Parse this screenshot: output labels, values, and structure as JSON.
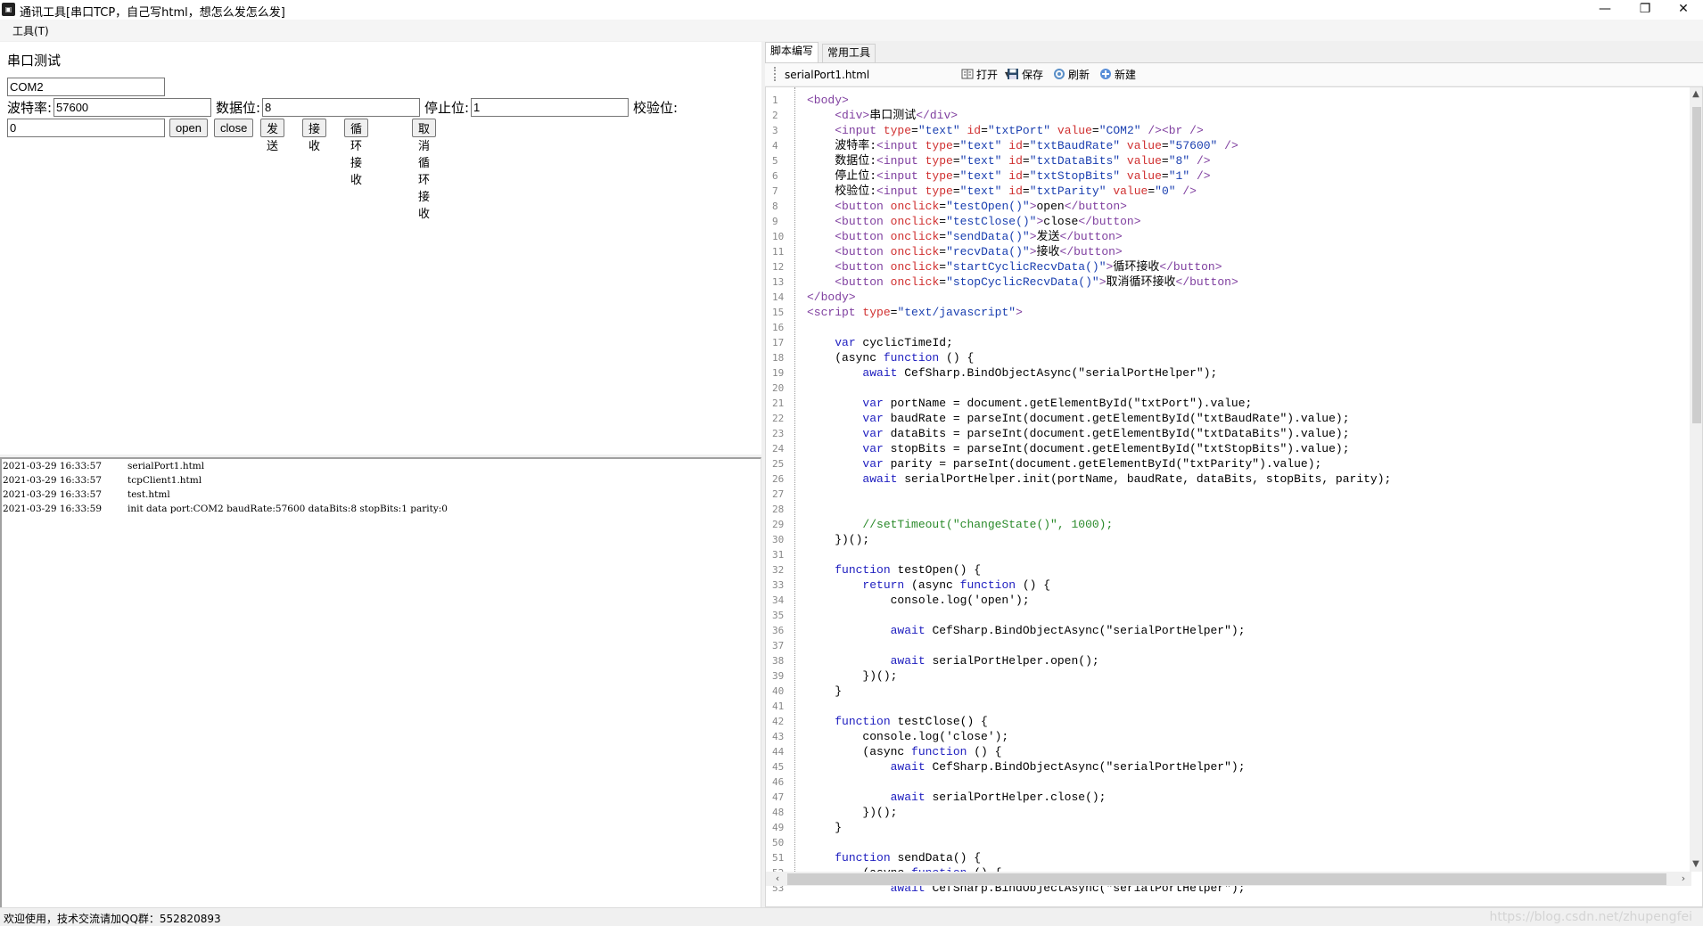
{
  "window": {
    "title": "通讯工具[串口TCP，自己写html，想怎么发怎么发]",
    "app_icon_glyph": "▣",
    "minimize_glyph": "—",
    "restore_glyph": "❐",
    "close_glyph": "✕"
  },
  "menu": {
    "items": [
      {
        "label": "工具(T)"
      }
    ]
  },
  "web_page": {
    "heading": "串口测试",
    "port_value": "COM2",
    "baud_label": "波特率:",
    "baud_value": "57600",
    "databits_label": "数据位:",
    "databits_value": "8",
    "stopbits_label": "停止位:",
    "stopbits_value": "1",
    "parity_label": "校验位:",
    "parity_value": "0",
    "buttons": {
      "open": "open",
      "close": "close",
      "send": "发送",
      "recv": "接收",
      "cyclic_recv": "循环接收",
      "cancel_cyclic_recv": "取消循环接收"
    }
  },
  "log": [
    {
      "time": "2021-03-29 16:33:57",
      "message": "serialPort1.html"
    },
    {
      "time": "2021-03-29 16:33:57",
      "message": "tcpClient1.html"
    },
    {
      "time": "2021-03-29 16:33:57",
      "message": "test.html"
    },
    {
      "time": "2021-03-29 16:33:59",
      "message": "init data port:COM2 baudRate:57600 dataBits:8 stopBits:1 parity:0"
    }
  ],
  "right_panel": {
    "tabs": [
      {
        "label": "脚本编写",
        "active": true
      },
      {
        "label": "常用工具",
        "active": false
      }
    ],
    "toolbar": {
      "selected_file": "serialPort1.html",
      "open_label": "打开",
      "save_label": "保存",
      "refresh_label": "刷新",
      "new_label": "新建"
    },
    "editor": {
      "scroll_vertical_fraction": 0.0,
      "lines": [
        [
          [
            "tag",
            "<body>"
          ]
        ],
        [
          [
            "plain",
            "    "
          ],
          [
            "tag",
            "<div>"
          ],
          [
            "plain",
            "串口测试"
          ],
          [
            "tag",
            "</div>"
          ]
        ],
        [
          [
            "plain",
            "    "
          ],
          [
            "tag",
            "<input "
          ],
          [
            "attr",
            "type"
          ],
          [
            "plain",
            "="
          ],
          [
            "val",
            "\"text\" "
          ],
          [
            "attr",
            "id"
          ],
          [
            "plain",
            "="
          ],
          [
            "val",
            "\"txtPort\" "
          ],
          [
            "attr",
            "value"
          ],
          [
            "plain",
            "="
          ],
          [
            "val",
            "\"COM2\" "
          ],
          [
            "tag",
            "/><br />"
          ]
        ],
        [
          [
            "plain",
            "    波特率:"
          ],
          [
            "tag",
            "<input "
          ],
          [
            "attr",
            "type"
          ],
          [
            "plain",
            "="
          ],
          [
            "val",
            "\"text\" "
          ],
          [
            "attr",
            "id"
          ],
          [
            "plain",
            "="
          ],
          [
            "val",
            "\"txtBaudRate\" "
          ],
          [
            "attr",
            "value"
          ],
          [
            "plain",
            "="
          ],
          [
            "val",
            "\"57600\" "
          ],
          [
            "tag",
            "/>"
          ]
        ],
        [
          [
            "plain",
            "    数据位:"
          ],
          [
            "tag",
            "<input "
          ],
          [
            "attr",
            "type"
          ],
          [
            "plain",
            "="
          ],
          [
            "val",
            "\"text\" "
          ],
          [
            "attr",
            "id"
          ],
          [
            "plain",
            "="
          ],
          [
            "val",
            "\"txtDataBits\" "
          ],
          [
            "attr",
            "value"
          ],
          [
            "plain",
            "="
          ],
          [
            "val",
            "\"8\" "
          ],
          [
            "tag",
            "/>"
          ]
        ],
        [
          [
            "plain",
            "    停止位:"
          ],
          [
            "tag",
            "<input "
          ],
          [
            "attr",
            "type"
          ],
          [
            "plain",
            "="
          ],
          [
            "val",
            "\"text\" "
          ],
          [
            "attr",
            "id"
          ],
          [
            "plain",
            "="
          ],
          [
            "val",
            "\"txtStopBits\" "
          ],
          [
            "attr",
            "value"
          ],
          [
            "plain",
            "="
          ],
          [
            "val",
            "\"1\" "
          ],
          [
            "tag",
            "/>"
          ]
        ],
        [
          [
            "plain",
            "    校验位:"
          ],
          [
            "tag",
            "<input "
          ],
          [
            "attr",
            "type"
          ],
          [
            "plain",
            "="
          ],
          [
            "val",
            "\"text\" "
          ],
          [
            "attr",
            "id"
          ],
          [
            "plain",
            "="
          ],
          [
            "val",
            "\"txtParity\" "
          ],
          [
            "attr",
            "value"
          ],
          [
            "plain",
            "="
          ],
          [
            "val",
            "\"0\" "
          ],
          [
            "tag",
            "/>"
          ]
        ],
        [
          [
            "plain",
            "    "
          ],
          [
            "tag",
            "<button "
          ],
          [
            "attr",
            "onclick"
          ],
          [
            "plain",
            "="
          ],
          [
            "val",
            "\"testOpen()\""
          ],
          [
            "tag",
            ">"
          ],
          [
            "plain",
            "open"
          ],
          [
            "tag",
            "</button>"
          ]
        ],
        [
          [
            "plain",
            "    "
          ],
          [
            "tag",
            "<button "
          ],
          [
            "attr",
            "onclick"
          ],
          [
            "plain",
            "="
          ],
          [
            "val",
            "\"testClose()\""
          ],
          [
            "tag",
            ">"
          ],
          [
            "plain",
            "close"
          ],
          [
            "tag",
            "</button>"
          ]
        ],
        [
          [
            "plain",
            "    "
          ],
          [
            "tag",
            "<button "
          ],
          [
            "attr",
            "onclick"
          ],
          [
            "plain",
            "="
          ],
          [
            "val",
            "\"sendData()\""
          ],
          [
            "tag",
            ">"
          ],
          [
            "plain",
            "发送"
          ],
          [
            "tag",
            "</button>"
          ]
        ],
        [
          [
            "plain",
            "    "
          ],
          [
            "tag",
            "<button "
          ],
          [
            "attr",
            "onclick"
          ],
          [
            "plain",
            "="
          ],
          [
            "val",
            "\"recvData()\""
          ],
          [
            "tag",
            ">"
          ],
          [
            "plain",
            "接收"
          ],
          [
            "tag",
            "</button>"
          ]
        ],
        [
          [
            "plain",
            "    "
          ],
          [
            "tag",
            "<button "
          ],
          [
            "attr",
            "onclick"
          ],
          [
            "plain",
            "="
          ],
          [
            "val",
            "\"startCyclicRecvData()\""
          ],
          [
            "tag",
            ">"
          ],
          [
            "plain",
            "循环接收"
          ],
          [
            "tag",
            "</button>"
          ]
        ],
        [
          [
            "plain",
            "    "
          ],
          [
            "tag",
            "<button "
          ],
          [
            "attr",
            "onclick"
          ],
          [
            "plain",
            "="
          ],
          [
            "val",
            "\"stopCyclicRecvData()\""
          ],
          [
            "tag",
            ">"
          ],
          [
            "plain",
            "取消循环接收"
          ],
          [
            "tag",
            "</button>"
          ]
        ],
        [
          [
            "tag",
            "</body>"
          ]
        ],
        [
          [
            "tag",
            "<script "
          ],
          [
            "attr",
            "type"
          ],
          [
            "plain",
            "="
          ],
          [
            "val",
            "\"text/javascript\""
          ],
          [
            "tag",
            ">"
          ]
        ],
        [],
        [
          [
            "plain",
            "    "
          ],
          [
            "kw",
            "var"
          ],
          [
            "plain",
            " cyclicTimeId;"
          ]
        ],
        [
          [
            "plain",
            "    (async "
          ],
          [
            "kw",
            "function"
          ],
          [
            "plain",
            " () {"
          ]
        ],
        [
          [
            "plain",
            "        "
          ],
          [
            "kw",
            "await"
          ],
          [
            "plain",
            " CefSharp.BindObjectAsync(\"serialPortHelper\");"
          ]
        ],
        [],
        [
          [
            "plain",
            "        "
          ],
          [
            "kw",
            "var"
          ],
          [
            "plain",
            " portName = document.getElementById(\"txtPort\").value;"
          ]
        ],
        [
          [
            "plain",
            "        "
          ],
          [
            "kw",
            "var"
          ],
          [
            "plain",
            " baudRate = parseInt(document.getElementById(\"txtBaudRate\").value);"
          ]
        ],
        [
          [
            "plain",
            "        "
          ],
          [
            "kw",
            "var"
          ],
          [
            "plain",
            " dataBits = parseInt(document.getElementById(\"txtDataBits\").value);"
          ]
        ],
        [
          [
            "plain",
            "        "
          ],
          [
            "kw",
            "var"
          ],
          [
            "plain",
            " stopBits = parseInt(document.getElementById(\"txtStopBits\").value);"
          ]
        ],
        [
          [
            "plain",
            "        "
          ],
          [
            "kw",
            "var"
          ],
          [
            "plain",
            " parity = parseInt(document.getElementById(\"txtParity\").value);"
          ]
        ],
        [
          [
            "plain",
            "        "
          ],
          [
            "kw",
            "await"
          ],
          [
            "plain",
            " serialPortHelper.init(portName, baudRate, dataBits, stopBits, parity);"
          ]
        ],
        [],
        [],
        [
          [
            "plain",
            "        "
          ],
          [
            "cm",
            "//setTimeout(\"changeState()\", 1000);"
          ]
        ],
        [
          [
            "plain",
            "    })();"
          ]
        ],
        [],
        [
          [
            "plain",
            "    "
          ],
          [
            "kw",
            "function"
          ],
          [
            "plain",
            " testOpen() {"
          ]
        ],
        [
          [
            "plain",
            "        "
          ],
          [
            "kw",
            "return"
          ],
          [
            "plain",
            " (async "
          ],
          [
            "kw",
            "function"
          ],
          [
            "plain",
            " () {"
          ]
        ],
        [
          [
            "plain",
            "            console.log('open');"
          ]
        ],
        [],
        [
          [
            "plain",
            "            "
          ],
          [
            "kw",
            "await"
          ],
          [
            "plain",
            " CefSharp.BindObjectAsync(\"serialPortHelper\");"
          ]
        ],
        [],
        [
          [
            "plain",
            "            "
          ],
          [
            "kw",
            "await"
          ],
          [
            "plain",
            " serialPortHelper.open();"
          ]
        ],
        [
          [
            "plain",
            "        })();"
          ]
        ],
        [
          [
            "plain",
            "    }"
          ]
        ],
        [],
        [
          [
            "plain",
            "    "
          ],
          [
            "kw",
            "function"
          ],
          [
            "plain",
            " testClose() {"
          ]
        ],
        [
          [
            "plain",
            "        console.log('close');"
          ]
        ],
        [
          [
            "plain",
            "        (async "
          ],
          [
            "kw",
            "function"
          ],
          [
            "plain",
            " () {"
          ]
        ],
        [
          [
            "plain",
            "            "
          ],
          [
            "kw",
            "await"
          ],
          [
            "plain",
            " CefSharp.BindObjectAsync(\"serialPortHelper\");"
          ]
        ],
        [],
        [
          [
            "plain",
            "            "
          ],
          [
            "kw",
            "await"
          ],
          [
            "plain",
            " serialPortHelper.close();"
          ]
        ],
        [
          [
            "plain",
            "        })();"
          ]
        ],
        [
          [
            "plain",
            "    }"
          ]
        ],
        [],
        [
          [
            "plain",
            "    "
          ],
          [
            "kw",
            "function"
          ],
          [
            "plain",
            " sendData() {"
          ]
        ],
        [
          [
            "plain",
            "        (async "
          ],
          [
            "kw",
            "function"
          ],
          [
            "plain",
            " () {"
          ]
        ],
        [
          [
            "plain",
            "            "
          ],
          [
            "kw",
            "await"
          ],
          [
            "plain",
            " CefSharp.BindObjectAsync(\"serialPortHelper\");"
          ]
        ]
      ]
    }
  },
  "statusbar": {
    "text": "欢迎使用，技术交流请加QQ群：552820893",
    "watermark": "https://blog.csdn.net/zhupengfei"
  },
  "colors": {
    "tag": "#8040a0",
    "attr": "#d03030",
    "value": "#1a3fb0",
    "keyword": "#2020c0",
    "comment": "#2a8a2a"
  }
}
